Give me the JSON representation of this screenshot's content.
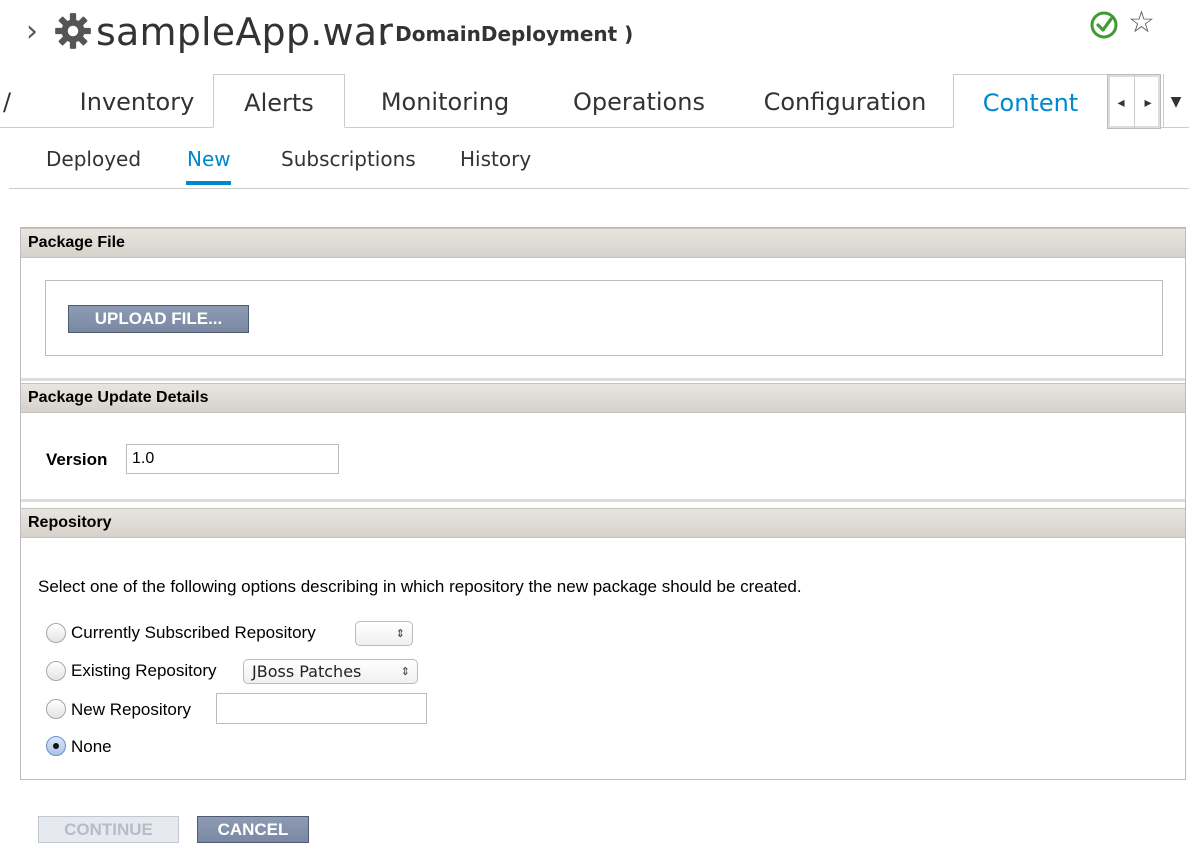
{
  "title": {
    "chevron": "›",
    "name": "sampleApp.war",
    "subtitle": "( DomainDeployment )",
    "status_icon": "check-circle-icon",
    "favorite_icon": "star-outline-icon",
    "accent_color": "#0088ce"
  },
  "tabs": {
    "partial_left": "/",
    "items": [
      "Inventory",
      "Alerts",
      "Monitoring",
      "Operations",
      "Configuration",
      "Content"
    ],
    "active": "Content",
    "scroll_left": "◂",
    "scroll_right": "▸",
    "menu": "▼"
  },
  "subtabs": {
    "items": [
      "Deployed",
      "New",
      "Subscriptions",
      "History"
    ],
    "active": "New"
  },
  "package_file": {
    "header": "Package File",
    "upload_label": "UPLOAD FILE..."
  },
  "package_update": {
    "header": "Package Update Details",
    "version_label": "Version",
    "version_value": "1.0"
  },
  "repository": {
    "header": "Repository",
    "description": "Select one of the following options describing in which repository the new package should be created.",
    "options": [
      {
        "label": "Currently Subscribed Repository",
        "selected": false,
        "select_value": ""
      },
      {
        "label": "Existing Repository",
        "selected": false,
        "select_value": "JBoss Patches"
      },
      {
        "label": "New Repository",
        "selected": false,
        "input_value": ""
      },
      {
        "label": "None",
        "selected": true
      }
    ],
    "select_arrows": "⇕"
  },
  "actions": {
    "continue_label": "CONTINUE",
    "cancel_label": "CANCEL"
  }
}
